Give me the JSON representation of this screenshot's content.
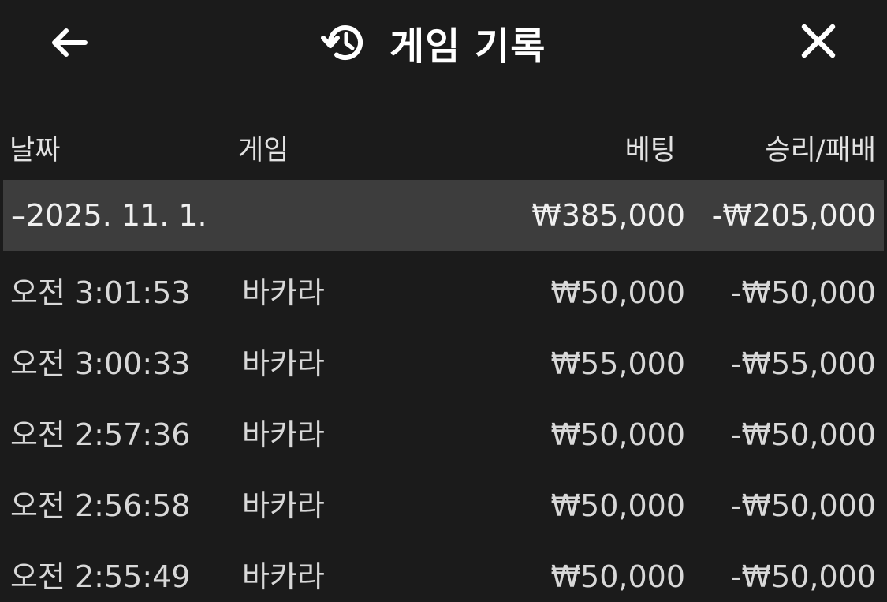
{
  "header": {
    "title": "게임 기록",
    "icons": {
      "back": "arrow-left-icon",
      "history": "history-icon",
      "close": "close-icon"
    }
  },
  "table": {
    "columns": [
      "날짜",
      "게임",
      "베팅",
      "승리/패배"
    ],
    "group": {
      "date": "–2025. 11. 1.",
      "bet_total": "₩385,000",
      "result_total": "-₩205,000"
    },
    "rows": [
      {
        "time": "오전 3:01:53",
        "game": "바카라",
        "bet": "₩50,000",
        "result": "-₩50,000"
      },
      {
        "time": "오전 3:00:33",
        "game": "바카라",
        "bet": "₩55,000",
        "result": "-₩55,000"
      },
      {
        "time": "오전 2:57:36",
        "game": "바카라",
        "bet": "₩50,000",
        "result": "-₩50,000"
      },
      {
        "time": "오전 2:56:58",
        "game": "바카라",
        "bet": "₩50,000",
        "result": "-₩50,000"
      },
      {
        "time": "오전 2:55:49",
        "game": "바카라",
        "bet": "₩50,000",
        "result": "-₩50,000"
      }
    ]
  },
  "colors": {
    "background": "#1b1b1b",
    "group_row_background": "#3d3d3d",
    "text": "#dcdcdc",
    "title": "#ffffff"
  }
}
